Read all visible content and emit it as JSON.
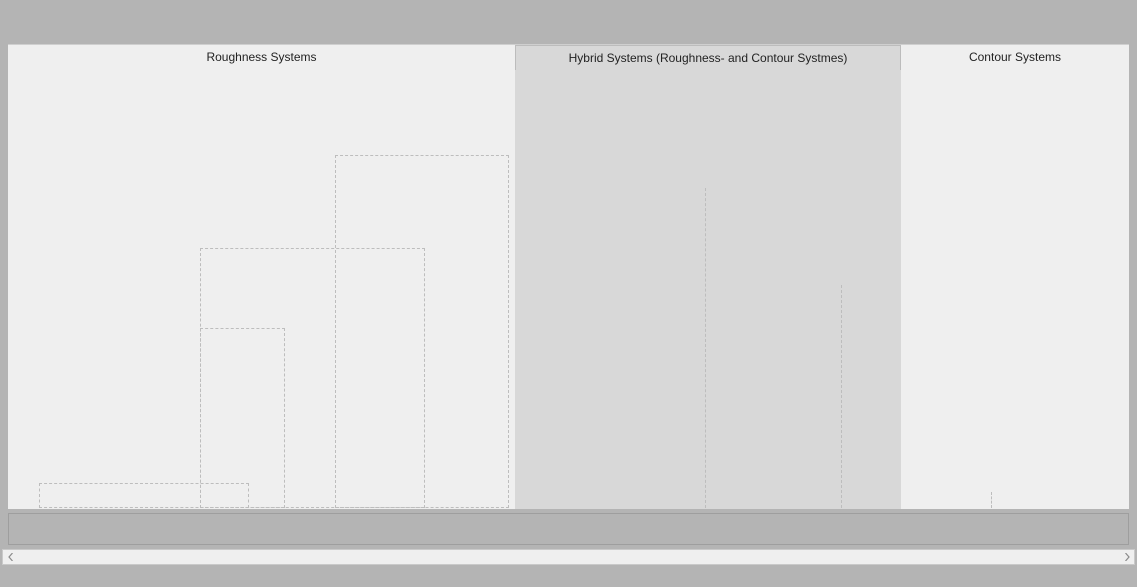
{
  "tabs": {
    "roughness": {
      "label": "Roughness Systems"
    },
    "hybrid": {
      "label": "Hybrid Systems (Roughness- and Contour Systmes)"
    },
    "contour": {
      "label": "Contour Systems"
    }
  },
  "selected_tab": "hybrid"
}
